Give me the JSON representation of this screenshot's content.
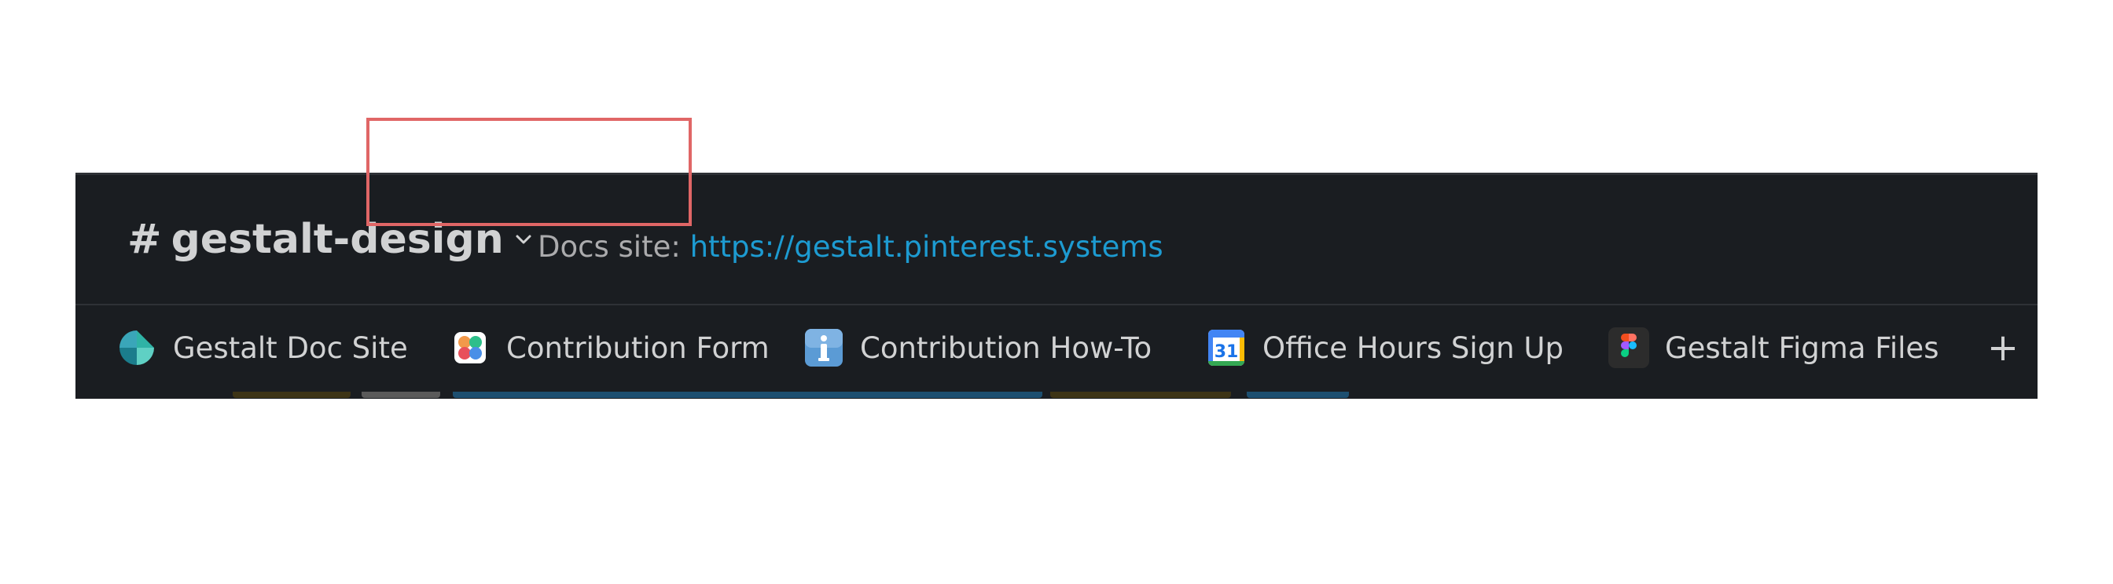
{
  "header": {
    "channel_hash": "#",
    "channel_name": "gestalt-design",
    "topic_prefix": "Docs site: ",
    "topic_link": "https://gestalt.pinterest.systems"
  },
  "bookmarks": [
    {
      "label": "Gestalt Doc Site",
      "icon": "gestalt-logo-icon"
    },
    {
      "label": "Contribution Form",
      "icon": "form-app-icon"
    },
    {
      "label": "Contribution How-To",
      "icon": "info-icon"
    },
    {
      "label": "Office Hours Sign Up",
      "icon": "calendar-icon"
    },
    {
      "label": "Gestalt Figma Files",
      "icon": "figma-icon"
    }
  ],
  "add_bookmark": "+",
  "colors": {
    "background": "#1a1d21",
    "text": "#d1d2d3",
    "link": "#1d9bd1",
    "highlight_box": "#e06666"
  }
}
